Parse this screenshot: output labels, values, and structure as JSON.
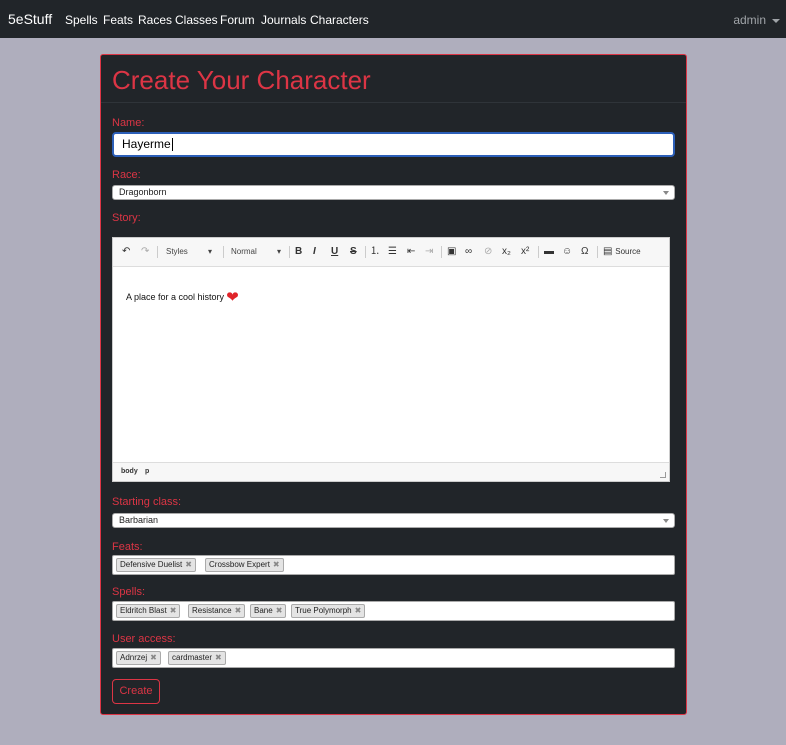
{
  "navbar": {
    "brand": "5eStuff",
    "links": [
      "Spells",
      "Feats",
      "Races",
      "Classes",
      "Forum",
      "Journals",
      "Characters"
    ],
    "user": "admin"
  },
  "form": {
    "title": "Create Your Character",
    "name_label": "Name:",
    "name_value": "Hayerme",
    "race_label": "Race:",
    "race_value": "Dragonborn",
    "story_label": "Story:",
    "story_text": "A place for a cool history",
    "starting_class_label": "Starting class:",
    "starting_class_value": "Barbarian",
    "feats_label": "Feats:",
    "feats": [
      "Defensive Duelist",
      "Crossbow Expert"
    ],
    "spells_label": "Spells:",
    "spells": [
      "Eldritch Blast",
      "Resistance",
      "Bane",
      "True Polymorph"
    ],
    "user_access_label": "User access:",
    "users": [
      "Adnrzej",
      "cardmaster"
    ],
    "submit_label": "Create"
  },
  "editor": {
    "styles_label": "Styles",
    "format_label": "Normal",
    "source_label": "Source",
    "path": [
      "body",
      "p"
    ],
    "heart_glyph": "❤"
  }
}
